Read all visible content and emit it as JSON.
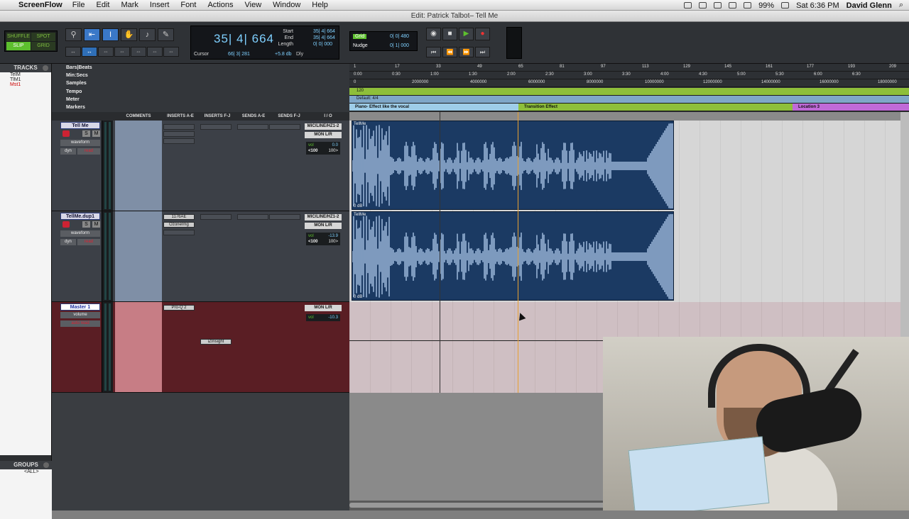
{
  "menubar": {
    "app": "ScreenFlow",
    "items": [
      "File",
      "Edit",
      "Mark",
      "Insert",
      "Font",
      "Actions",
      "View",
      "Window",
      "Help"
    ],
    "battery": "99%",
    "clock": "Sat 6:36 PM",
    "user": "David Glenn"
  },
  "window": {
    "title": "Edit: Patrick Talbot– Tell Me"
  },
  "toolbar": {
    "modes": [
      "SHUFFLE",
      "SPOT",
      "SLIP",
      "GRID"
    ],
    "active_mode": "SLIP",
    "main_counter": "35| 4| 664",
    "start_label": "Start",
    "end_label": "End",
    "length_label": "Length",
    "start": "35| 4| 664",
    "end": "35| 4| 664",
    "length": "0| 0| 000",
    "cursor_label": "Cursor",
    "cursor_val": "66| 3| 281",
    "db_val": "+5.8 db",
    "dly": "Dly",
    "grid_label": "Grid",
    "grid_val": "0| 0| 480",
    "nudge_label": "Nudge",
    "nudge_val": "0| 1| 000"
  },
  "left": {
    "tracks_title": "TRACKS",
    "tracks": [
      "TelM",
      "TlM1",
      "Mst1"
    ],
    "groups_title": "GROUPS",
    "groups": [
      "<ALL>"
    ]
  },
  "rulers": {
    "labels": [
      "Bars|Beats",
      "Min:Secs",
      "Samples",
      "Tempo",
      "Meter",
      "Markers"
    ],
    "bars": [
      "1",
      "17",
      "33",
      "49",
      "65",
      "81",
      "97",
      "113",
      "129",
      "145",
      "161",
      "177",
      "193",
      "209"
    ],
    "mins": [
      "0:00",
      "0:30",
      "1:00",
      "1:30",
      "2:00",
      "2:30",
      "3:00",
      "3:30",
      "4:00",
      "4:30",
      "5:00",
      "5:30",
      "6:00",
      "6:30"
    ],
    "samples": [
      "0",
      "2000000",
      "4000000",
      "6000000",
      "8000000",
      "10000000",
      "12000000",
      "14000000",
      "16000000",
      "18000000"
    ],
    "tempo": "120",
    "meter": "Default: 4/4",
    "markers": [
      {
        "label": "Piano- Effect like the vocal",
        "color": "#9ecde8"
      },
      {
        "label": "Transition Effect",
        "color": "#8ebf3a"
      },
      {
        "label": "Location 3",
        "color": "#c06ad8"
      }
    ]
  },
  "columns": [
    "COMMENTS",
    "INSERTS A-E",
    "INSERTS F-J",
    "SENDS A-E",
    "SENDS F-J",
    "I / O"
  ],
  "tracks": [
    {
      "name": "Tell Me",
      "solo": "S",
      "mute": "M",
      "view": "waveform",
      "auto_a": "dyn",
      "auto_b": "read",
      "inserts": [],
      "io_in": "MIC/LINE/HZ1-2",
      "io_out": "MON L/R",
      "vol_label": "vol",
      "vol": "0.0",
      "pan_l": "<100",
      "pan_r": "100>",
      "clip": "TellMe",
      "clip_db": "0 dB"
    },
    {
      "name": "TellMe.dup1",
      "solo": "S",
      "mute": "M",
      "view": "waveform",
      "auto_a": "dyn",
      "auto_b": "read",
      "inserts": [
        "1176AE",
        "OzoneImg"
      ],
      "io_in": "MIC/LINE/HZ1-2",
      "io_out": "MON L/R",
      "vol_label": "vol",
      "vol": "-13.9",
      "pan_l": "<100",
      "pan_r": "100>",
      "clip": "TellMe",
      "clip_db": "0 dB"
    },
    {
      "name": "Master 1",
      "view": "volume",
      "auto": "auto read",
      "inserts": [
        "Pro-Q 2"
      ],
      "insert_fj": "iZInsight",
      "io_out": "MON L/R",
      "vol_label": "vol",
      "vol": "-10.3"
    }
  ]
}
